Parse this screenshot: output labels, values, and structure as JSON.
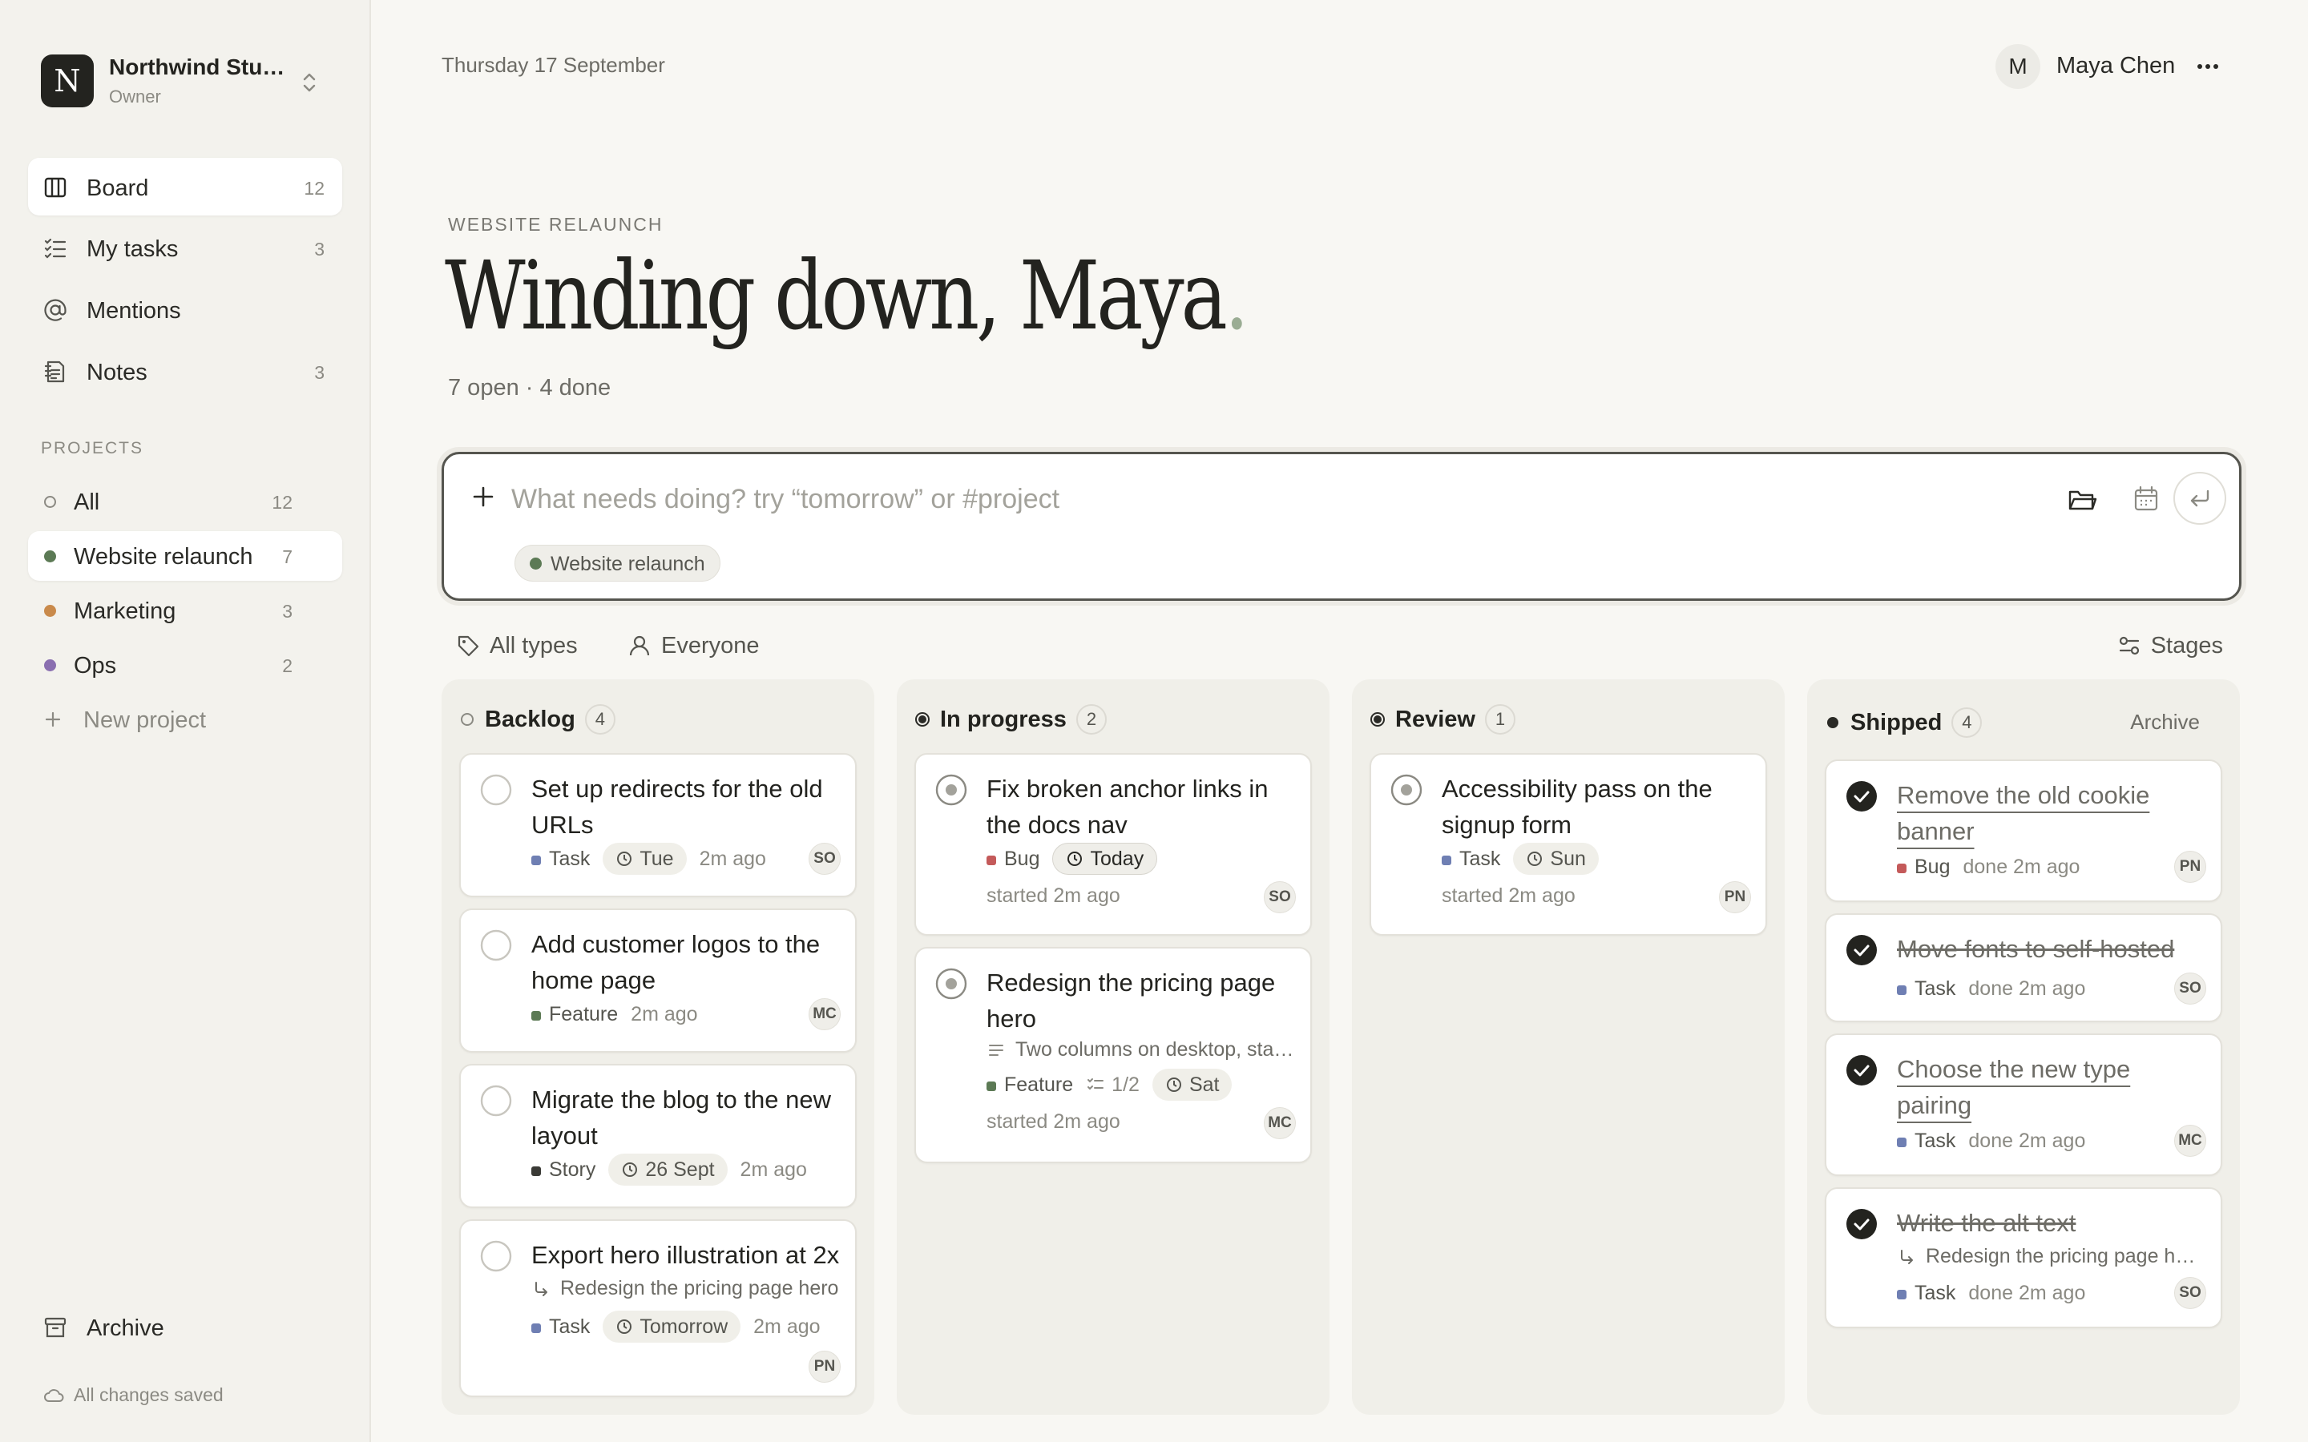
{
  "workspace": {
    "initial": "N",
    "name": "Northwind Studio",
    "role": "Owner"
  },
  "nav": [
    {
      "label": "Board",
      "count": "12",
      "icon": "board-icon"
    },
    {
      "label": "My tasks",
      "count": "3",
      "icon": "tasks-icon"
    },
    {
      "label": "Mentions",
      "count": "",
      "icon": "at-icon"
    },
    {
      "label": "Notes",
      "count": "3",
      "icon": "notes-icon"
    }
  ],
  "projects_heading": "PROJECTS",
  "projects": [
    {
      "label": "All",
      "count": "12",
      "color": "#8b8a83"
    },
    {
      "label": "Website relaunch",
      "count": "7",
      "color": "#5c7a55"
    },
    {
      "label": "Marketing",
      "count": "3",
      "color": "#c98a4b"
    },
    {
      "label": "Ops",
      "count": "2",
      "color": "#8a6fb0"
    }
  ],
  "new_project": "New project",
  "footer": {
    "archive": "Archive",
    "saved": "All changes saved"
  },
  "header": {
    "date": "Thursday 17 September",
    "user_initial": "M",
    "user_name": "Maya Chen"
  },
  "page": {
    "kicker": "WEBSITE RELAUNCH",
    "title": "Winding down, Maya",
    "title_dot": ".",
    "summary": "7 open · 4 done"
  },
  "composer": {
    "placeholder": "What needs doing?  try “tomorrow” or #project",
    "project_chip": "Website relaunch"
  },
  "filters": {
    "types": "All types",
    "people": "Everyone",
    "stages": "Stages"
  },
  "columns": [
    {
      "name": "Backlog",
      "count": "4",
      "cards": [
        {
          "title": "Set up redirects for the old URLs",
          "type": "Task",
          "due": "Tue",
          "ago": "2m ago",
          "assignee": "SO"
        },
        {
          "title": "Add customer logos to the home page",
          "type": "Feature",
          "ago": "2m ago",
          "assignee": "MC"
        },
        {
          "title": "Migrate the blog to the new layout",
          "type": "Story",
          "due": "26 Sept",
          "ago": "2m ago"
        },
        {
          "title": "Export hero illustration at 2x",
          "parent": "Redesign the pricing page hero",
          "type": "Task",
          "due": "Tomorrow",
          "ago": "2m ago",
          "assignee": "PN"
        }
      ]
    },
    {
      "name": "In progress",
      "count": "2",
      "cards": [
        {
          "title": "Fix broken anchor links in the docs nav",
          "type": "Bug",
          "due": "Today",
          "started": "started 2m ago",
          "assignee": "SO"
        },
        {
          "title": "Redesign the pricing page hero",
          "note": "Two columns on desktop, stacked on mobile",
          "type": "Feature",
          "subtasks": "1/2",
          "due": "Sat",
          "started": "started 2m ago",
          "assignee": "MC"
        }
      ]
    },
    {
      "name": "Review",
      "count": "1",
      "cards": [
        {
          "title": "Accessibility pass on the signup form",
          "type": "Task",
          "due": "Sun",
          "started": "started 2m ago",
          "assignee": "PN"
        }
      ]
    },
    {
      "name": "Shipped",
      "count": "4",
      "action": "Archive",
      "cards": [
        {
          "title": "Remove the old cookie banner",
          "type": "Bug",
          "done": "done 2m ago",
          "assignee": "PN"
        },
        {
          "title": "Move fonts to self-hosted",
          "type": "Task",
          "done": "done 2m ago",
          "assignee": "SO"
        },
        {
          "title": "Choose the new type pairing",
          "type": "Task",
          "done": "done 2m ago",
          "assignee": "MC"
        },
        {
          "title": "Write the alt text",
          "parent": "Redesign the pricing page hero",
          "type": "Task",
          "done": "done 2m ago",
          "assignee": "SO"
        }
      ]
    }
  ],
  "type_colors": {
    "Task": "#6f7fb3",
    "Bug": "#c45a5a",
    "Feature": "#5c7a55",
    "Story": "#3b3b36"
  }
}
